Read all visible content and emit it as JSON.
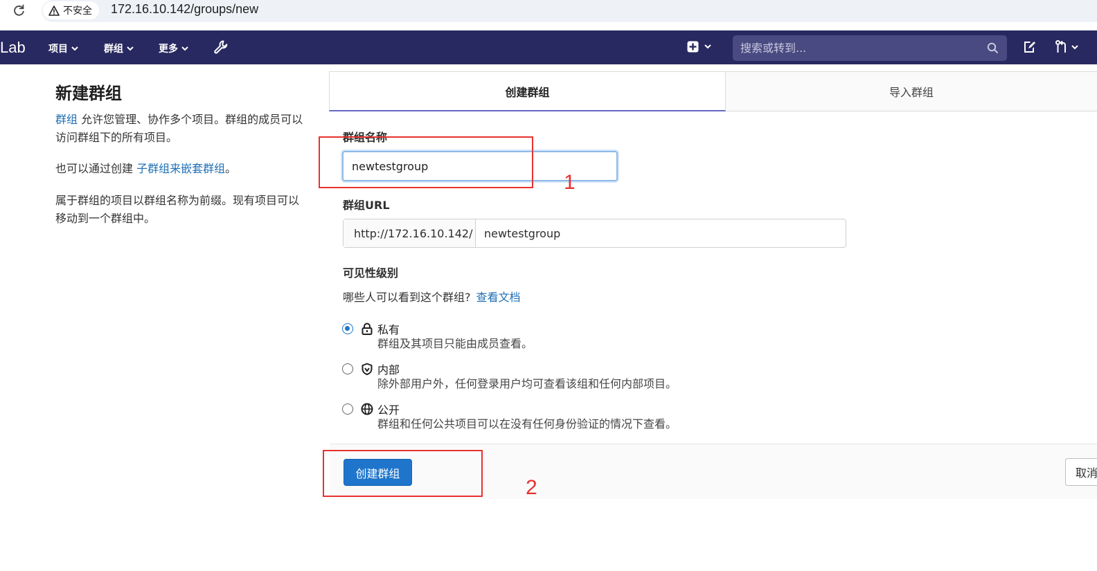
{
  "browser": {
    "security_label": "不安全",
    "url": "172.16.10.142/groups/new"
  },
  "navbar": {
    "brand": "Lab",
    "items": [
      {
        "label": "项目"
      },
      {
        "label": "群组"
      },
      {
        "label": "更多"
      }
    ],
    "search_placeholder": "搜索或转到..."
  },
  "sidebar": {
    "title": "新建群组",
    "para1_link": "群组",
    "para1_text": " 允许您管理、协作多个项目。群组的成员可以访问群组下的所有项目。",
    "para2_text": "也可以通过创建 ",
    "para2_link": "子群组来嵌套群组",
    "para2_end": "。",
    "para3_text": "属于群组的项目以群组名称为前缀。现有项目可以移动到一个群组中。"
  },
  "tabs": [
    {
      "label": "创建群组",
      "active": true
    },
    {
      "label": "导入群组",
      "active": false
    }
  ],
  "form": {
    "name_label": "群组名称",
    "name_value": "newtestgroup",
    "url_label": "群组URL",
    "url_prefix": "http://172.16.10.142/",
    "url_path": "newtestgroup",
    "visibility_label": "可见性级别",
    "visibility_help": "哪些人可以看到这个群组?",
    "visibility_help_link": "查看文档",
    "visibility_options": [
      {
        "icon": "lock-icon",
        "title": "私有",
        "desc": "群组及其项目只能由成员查看。",
        "checked": true
      },
      {
        "icon": "shield-icon",
        "title": "内部",
        "desc": "除外部用户外，任何登录用户均可查看该组和任何内部项目。",
        "checked": false
      },
      {
        "icon": "globe-icon",
        "title": "公开",
        "desc": "群组和任何公共项目可以在没有任何身份验证的情况下查看。",
        "checked": false
      }
    ]
  },
  "actions": {
    "create_label": "创建群组",
    "cancel_label": "取消"
  },
  "annotations": {
    "step1": "1",
    "step2": "2"
  },
  "colors": {
    "navbar": "#292961",
    "primary": "#1f75cb",
    "link": "#1f6fb5",
    "annotation": "#e8312f"
  }
}
